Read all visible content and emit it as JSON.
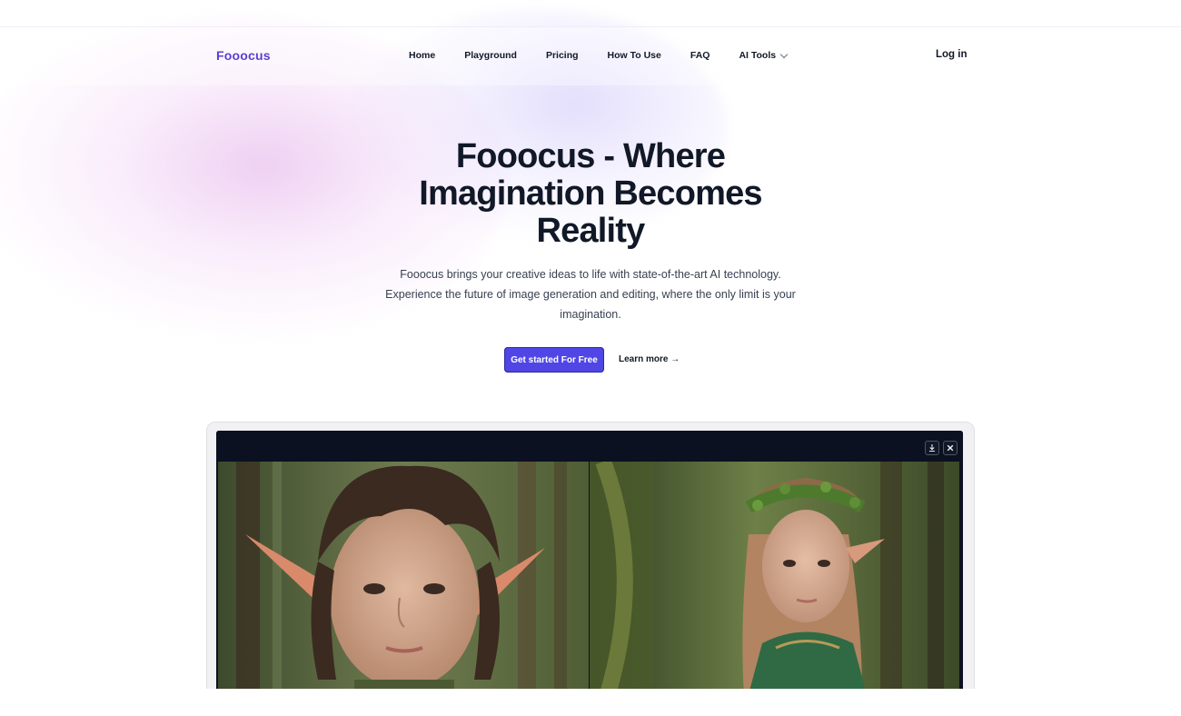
{
  "brand": {
    "name": "Fooocus"
  },
  "nav": {
    "home": "Home",
    "playground": "Playground",
    "pricing": "Pricing",
    "how_to_use": "How To Use",
    "faq": "FAQ",
    "ai_tools": "AI Tools"
  },
  "auth": {
    "login": "Log in"
  },
  "hero": {
    "title_line1": "Fooocus - Where",
    "title_line2": "Imagination Becomes",
    "title_line3": "Reality",
    "subtitle": "Fooocus brings your creative ideas to life with state-of-the-art AI technology. Experience the future of image generation and editing, where the only limit is your imagination.",
    "primary_cta": "Get started For Free",
    "secondary_cta": "Learn more →"
  },
  "preview": {
    "download_icon": "download-icon",
    "close_icon": "close-icon",
    "images": [
      "elf-portrait-boy",
      "elf-portrait-girl"
    ]
  },
  "colors": {
    "brand": "#5b3fd1",
    "primary_button": "#4f46e5",
    "preview_frame": "#0b1120"
  }
}
